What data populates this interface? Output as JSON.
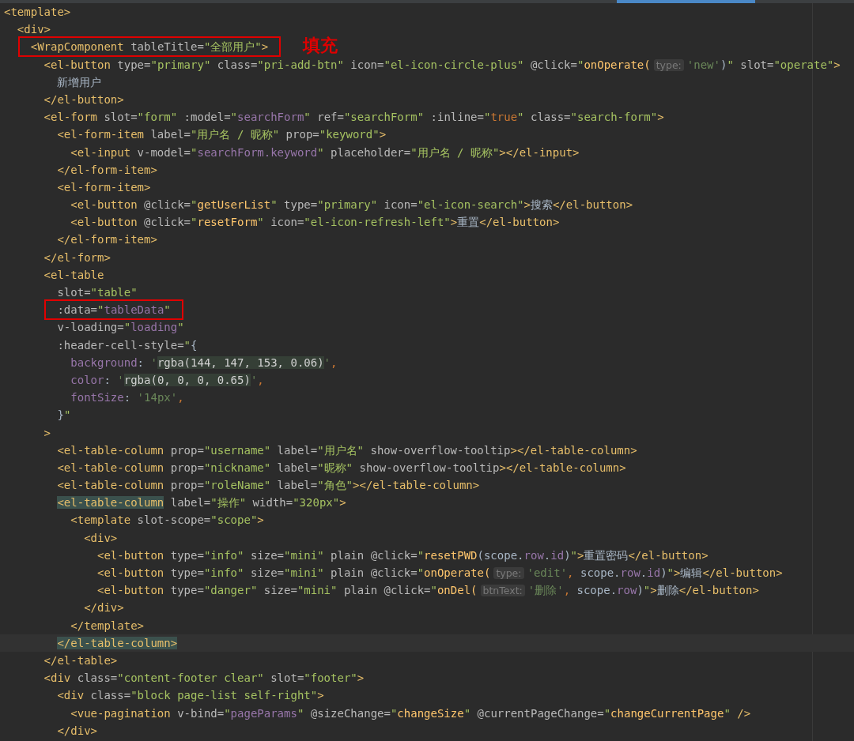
{
  "editor": {
    "lines": [
      {
        "tokens": [
          {
            "kind": "tag",
            "text": "<template>"
          }
        ]
      },
      {
        "tokens": [
          {
            "kind": "tag",
            "text": "  <div>"
          }
        ]
      },
      {
        "boxed": true,
        "note": "填充",
        "tokens": [
          {
            "kind": "tag",
            "text": "    <WrapComponent"
          },
          {
            "kind": "attr",
            "text": " tableTitle="
          },
          {
            "kind": "str",
            "text": "\"全部用户\""
          },
          {
            "kind": "tag",
            "text": ">"
          }
        ]
      },
      {
        "tokens": [
          {
            "kind": "tag",
            "text": "      <el-button"
          },
          {
            "kind": "attr",
            "text": " type="
          },
          {
            "kind": "str",
            "text": "\"primary\""
          },
          {
            "kind": "attr",
            "text": " class="
          },
          {
            "kind": "str",
            "text": "\"pri-add-btn\""
          },
          {
            "kind": "attr",
            "text": " icon="
          },
          {
            "kind": "str",
            "text": "\"el-icon-circle-plus\""
          },
          {
            "kind": "attr",
            "text": " @click="
          },
          {
            "kind": "str",
            "text": "\""
          },
          {
            "kind": "fn",
            "text": "onOperate("
          },
          {
            "kind": "hint",
            "text": "type:"
          },
          {
            "kind": "sq",
            "text": "'new'"
          },
          {
            "kind": "text",
            "text": ")"
          },
          {
            "kind": "str",
            "text": "\""
          },
          {
            "kind": "attr",
            "text": " slot="
          },
          {
            "kind": "str",
            "text": "\"operate\""
          },
          {
            "kind": "tag",
            "text": ">"
          }
        ]
      },
      {
        "tokens": [
          {
            "kind": "text",
            "text": "        新增用户"
          }
        ]
      },
      {
        "tokens": [
          {
            "kind": "tag",
            "text": "      </el-button>"
          }
        ]
      },
      {
        "tokens": [
          {
            "kind": "tag",
            "text": "      <el-form"
          },
          {
            "kind": "attr",
            "text": " slot="
          },
          {
            "kind": "str",
            "text": "\"form\""
          },
          {
            "kind": "attr",
            "text": " :model="
          },
          {
            "kind": "str",
            "text": "\""
          },
          {
            "kind": "bind",
            "text": "searchForm"
          },
          {
            "kind": "str",
            "text": "\""
          },
          {
            "kind": "attr",
            "text": " ref="
          },
          {
            "kind": "str",
            "text": "\"searchForm\""
          },
          {
            "kind": "attr",
            "text": " :inline="
          },
          {
            "kind": "str",
            "text": "\""
          },
          {
            "kind": "kw",
            "text": "true"
          },
          {
            "kind": "str",
            "text": "\""
          },
          {
            "kind": "attr",
            "text": " class="
          },
          {
            "kind": "str",
            "text": "\"search-form\""
          },
          {
            "kind": "tag",
            "text": ">"
          }
        ]
      },
      {
        "tokens": [
          {
            "kind": "tag",
            "text": "        <el-form-item"
          },
          {
            "kind": "attr",
            "text": " label="
          },
          {
            "kind": "str",
            "text": "\"用户名 / 昵称\""
          },
          {
            "kind": "attr",
            "text": " prop="
          },
          {
            "kind": "str",
            "text": "\"keyword\""
          },
          {
            "kind": "tag",
            "text": ">"
          }
        ]
      },
      {
        "tokens": [
          {
            "kind": "tag",
            "text": "          <el-input"
          },
          {
            "kind": "attr",
            "text": " v-model="
          },
          {
            "kind": "str",
            "text": "\""
          },
          {
            "kind": "bind",
            "text": "searchForm.keyword"
          },
          {
            "kind": "str",
            "text": "\""
          },
          {
            "kind": "attr",
            "text": " placeholder="
          },
          {
            "kind": "str",
            "text": "\"用户名 / 昵称\""
          },
          {
            "kind": "tag",
            "text": "></el-input>"
          }
        ]
      },
      {
        "tokens": [
          {
            "kind": "tag",
            "text": "        </el-form-item>"
          }
        ]
      },
      {
        "tokens": [
          {
            "kind": "tag",
            "text": "        <el-form-item>"
          }
        ]
      },
      {
        "tokens": [
          {
            "kind": "tag",
            "text": "          <el-button"
          },
          {
            "kind": "attr",
            "text": " @click="
          },
          {
            "kind": "str",
            "text": "\""
          },
          {
            "kind": "fn",
            "text": "getUserList"
          },
          {
            "kind": "str",
            "text": "\""
          },
          {
            "kind": "attr",
            "text": " type="
          },
          {
            "kind": "str",
            "text": "\"primary\""
          },
          {
            "kind": "attr",
            "text": " icon="
          },
          {
            "kind": "str",
            "text": "\"el-icon-search\""
          },
          {
            "kind": "tag",
            "text": ">"
          },
          {
            "kind": "text",
            "text": "搜索"
          },
          {
            "kind": "tag",
            "text": "</el-button>"
          }
        ]
      },
      {
        "tokens": [
          {
            "kind": "tag",
            "text": "          <el-button"
          },
          {
            "kind": "attr",
            "text": " @click="
          },
          {
            "kind": "str",
            "text": "\""
          },
          {
            "kind": "fn",
            "text": "resetForm"
          },
          {
            "kind": "str",
            "text": "\""
          },
          {
            "kind": "attr",
            "text": " icon="
          },
          {
            "kind": "str",
            "text": "\"el-icon-refresh-left\""
          },
          {
            "kind": "tag",
            "text": ">"
          },
          {
            "kind": "text",
            "text": "重置"
          },
          {
            "kind": "tag",
            "text": "</el-button>"
          }
        ]
      },
      {
        "tokens": [
          {
            "kind": "tag",
            "text": "        </el-form-item>"
          }
        ]
      },
      {
        "tokens": [
          {
            "kind": "tag",
            "text": "      </el-form>"
          }
        ]
      },
      {
        "tokens": [
          {
            "kind": "tag",
            "text": "      <el-table"
          }
        ]
      },
      {
        "tokens": [
          {
            "kind": "attr",
            "text": "        slot="
          },
          {
            "kind": "str",
            "text": "\"table\""
          }
        ]
      },
      {
        "boxed": true,
        "tokens": [
          {
            "kind": "attr",
            "text": "        :data="
          },
          {
            "kind": "str",
            "text": "\""
          },
          {
            "kind": "bind",
            "text": "tableData"
          },
          {
            "kind": "str",
            "text": "\""
          }
        ]
      },
      {
        "tokens": [
          {
            "kind": "attr",
            "text": "        v-loading="
          },
          {
            "kind": "str",
            "text": "\""
          },
          {
            "kind": "bind",
            "text": "loading"
          },
          {
            "kind": "str",
            "text": "\""
          }
        ]
      },
      {
        "tokens": [
          {
            "kind": "attr",
            "text": "        :header-cell-style="
          },
          {
            "kind": "str",
            "text": "\""
          },
          {
            "kind": "text",
            "text": "{"
          }
        ]
      },
      {
        "tokens": [
          {
            "kind": "key",
            "text": "          background"
          },
          {
            "kind": "text",
            "text": ": "
          },
          {
            "kind": "sq",
            "text": "'"
          },
          {
            "kind": "css",
            "text": "rgba(144, 147, 153, 0.06)"
          },
          {
            "kind": "sq",
            "text": "'"
          },
          {
            "kind": "kw",
            "text": ","
          }
        ]
      },
      {
        "tokens": [
          {
            "kind": "key",
            "text": "          color"
          },
          {
            "kind": "text",
            "text": ": "
          },
          {
            "kind": "sq",
            "text": "'"
          },
          {
            "kind": "css",
            "text": "rgba(0, 0, 0, 0.65)"
          },
          {
            "kind": "sq",
            "text": "'"
          },
          {
            "kind": "kw",
            "text": ","
          }
        ]
      },
      {
        "tokens": [
          {
            "kind": "key",
            "text": "          fontSize"
          },
          {
            "kind": "text",
            "text": ": "
          },
          {
            "kind": "sq",
            "text": "'14px'"
          },
          {
            "kind": "kw",
            "text": ","
          }
        ]
      },
      {
        "tokens": [
          {
            "kind": "text",
            "text": "        }"
          },
          {
            "kind": "str",
            "text": "\""
          }
        ]
      },
      {
        "tokens": [
          {
            "kind": "tag",
            "text": "      >"
          }
        ]
      },
      {
        "tokens": [
          {
            "kind": "tag",
            "text": "        <el-table-column"
          },
          {
            "kind": "attr",
            "text": " prop="
          },
          {
            "kind": "str",
            "text": "\"username\""
          },
          {
            "kind": "attr",
            "text": " label="
          },
          {
            "kind": "str",
            "text": "\"用户名\""
          },
          {
            "kind": "attr",
            "text": " show-overflow-tooltip"
          },
          {
            "kind": "tag",
            "text": "></el-table-column>"
          }
        ]
      },
      {
        "tokens": [
          {
            "kind": "tag",
            "text": "        <el-table-column"
          },
          {
            "kind": "attr",
            "text": " prop="
          },
          {
            "kind": "str",
            "text": "\"nickname\""
          },
          {
            "kind": "attr",
            "text": " label="
          },
          {
            "kind": "str",
            "text": "\"昵称\""
          },
          {
            "kind": "attr",
            "text": " show-overflow-tooltip"
          },
          {
            "kind": "tag",
            "text": "></el-table-column>"
          }
        ]
      },
      {
        "tokens": [
          {
            "kind": "tag",
            "text": "        <el-table-column"
          },
          {
            "kind": "attr",
            "text": " prop="
          },
          {
            "kind": "str",
            "text": "\"roleName\""
          },
          {
            "kind": "attr",
            "text": " label="
          },
          {
            "kind": "str",
            "text": "\"角色\""
          },
          {
            "kind": "tag",
            "text": "></el-table-column>"
          }
        ]
      },
      {
        "tokens": [
          {
            "kind": "match",
            "text": "        <el-table-column"
          },
          {
            "kind": "attr",
            "text": " label="
          },
          {
            "kind": "str",
            "text": "\"操作\""
          },
          {
            "kind": "attr",
            "text": " width="
          },
          {
            "kind": "str",
            "text": "\"320px\""
          },
          {
            "kind": "tag",
            "text": ">"
          }
        ]
      },
      {
        "tokens": [
          {
            "kind": "tag",
            "text": "          <template"
          },
          {
            "kind": "attr",
            "text": " slot-scope="
          },
          {
            "kind": "str",
            "text": "\"scope\""
          },
          {
            "kind": "tag",
            "text": ">"
          }
        ]
      },
      {
        "tokens": [
          {
            "kind": "tag",
            "text": "            <div>"
          }
        ]
      },
      {
        "tokens": [
          {
            "kind": "tag",
            "text": "              <el-button"
          },
          {
            "kind": "attr",
            "text": " type="
          },
          {
            "kind": "str",
            "text": "\"info\""
          },
          {
            "kind": "attr",
            "text": " size="
          },
          {
            "kind": "str",
            "text": "\"mini\""
          },
          {
            "kind": "attr",
            "text": " plain @click="
          },
          {
            "kind": "str",
            "text": "\""
          },
          {
            "kind": "fn",
            "text": "resetPWD"
          },
          {
            "kind": "text",
            "text": "(scope."
          },
          {
            "kind": "bind",
            "text": "row"
          },
          {
            "kind": "text",
            "text": "."
          },
          {
            "kind": "bind",
            "text": "id"
          },
          {
            "kind": "text",
            "text": ")"
          },
          {
            "kind": "str",
            "text": "\""
          },
          {
            "kind": "tag",
            "text": ">"
          },
          {
            "kind": "text",
            "text": "重置密码"
          },
          {
            "kind": "tag",
            "text": "</el-button>"
          }
        ]
      },
      {
        "tokens": [
          {
            "kind": "tag",
            "text": "              <el-button"
          },
          {
            "kind": "attr",
            "text": " type="
          },
          {
            "kind": "str",
            "text": "\"info\""
          },
          {
            "kind": "attr",
            "text": " size="
          },
          {
            "kind": "str",
            "text": "\"mini\""
          },
          {
            "kind": "attr",
            "text": " plain @click="
          },
          {
            "kind": "str",
            "text": "\""
          },
          {
            "kind": "fn",
            "text": "onOperate("
          },
          {
            "kind": "hint",
            "text": "type:"
          },
          {
            "kind": "sq",
            "text": "'edit'"
          },
          {
            "kind": "kw",
            "text": ","
          },
          {
            "kind": "text",
            "text": " scope."
          },
          {
            "kind": "bind",
            "text": "row"
          },
          {
            "kind": "text",
            "text": "."
          },
          {
            "kind": "bind",
            "text": "id"
          },
          {
            "kind": "text",
            "text": ")"
          },
          {
            "kind": "str",
            "text": "\""
          },
          {
            "kind": "tag",
            "text": ">"
          },
          {
            "kind": "text",
            "text": "编辑"
          },
          {
            "kind": "tag",
            "text": "</el-button>"
          }
        ]
      },
      {
        "tokens": [
          {
            "kind": "tag",
            "text": "              <el-button"
          },
          {
            "kind": "attr",
            "text": " type="
          },
          {
            "kind": "str",
            "text": "\"danger\""
          },
          {
            "kind": "attr",
            "text": " size="
          },
          {
            "kind": "str",
            "text": "\"mini\""
          },
          {
            "kind": "attr",
            "text": " plain @click="
          },
          {
            "kind": "str",
            "text": "\""
          },
          {
            "kind": "fn",
            "text": "onDel("
          },
          {
            "kind": "hint",
            "text": "btnText:"
          },
          {
            "kind": "sq",
            "text": "'删除'"
          },
          {
            "kind": "kw",
            "text": ","
          },
          {
            "kind": "text",
            "text": " scope."
          },
          {
            "kind": "bind",
            "text": "row"
          },
          {
            "kind": "text",
            "text": ")"
          },
          {
            "kind": "str",
            "text": "\""
          },
          {
            "kind": "tag",
            "text": ">"
          },
          {
            "kind": "text",
            "text": "删除"
          },
          {
            "kind": "tag",
            "text": "</el-button>"
          }
        ]
      },
      {
        "tokens": [
          {
            "kind": "tag",
            "text": "            </div>"
          }
        ]
      },
      {
        "tokens": [
          {
            "kind": "tag",
            "text": "          </template>"
          }
        ]
      },
      {
        "current": true,
        "tokens": [
          {
            "kind": "match",
            "text": "        </el-table-column>"
          }
        ]
      },
      {
        "tokens": [
          {
            "kind": "tag",
            "text": "      </el-table>"
          }
        ]
      },
      {
        "tokens": [
          {
            "kind": "tag",
            "text": "      <div"
          },
          {
            "kind": "attr",
            "text": " class="
          },
          {
            "kind": "str",
            "text": "\"content-footer clear\""
          },
          {
            "kind": "attr",
            "text": " slot="
          },
          {
            "kind": "str",
            "text": "\"footer\""
          },
          {
            "kind": "tag",
            "text": ">"
          }
        ]
      },
      {
        "tokens": [
          {
            "kind": "tag",
            "text": "        <div"
          },
          {
            "kind": "attr",
            "text": " class="
          },
          {
            "kind": "str",
            "text": "\"block page-list self-right\""
          },
          {
            "kind": "tag",
            "text": ">"
          }
        ]
      },
      {
        "tokens": [
          {
            "kind": "tag",
            "text": "          <vue-pagination"
          },
          {
            "kind": "attr",
            "text": " v-bind="
          },
          {
            "kind": "str",
            "text": "\""
          },
          {
            "kind": "bind",
            "text": "pageParams"
          },
          {
            "kind": "str",
            "text": "\""
          },
          {
            "kind": "attr",
            "text": " @sizeChange="
          },
          {
            "kind": "str",
            "text": "\""
          },
          {
            "kind": "fn",
            "text": "changeSize"
          },
          {
            "kind": "str",
            "text": "\""
          },
          {
            "kind": "attr",
            "text": " @currentPageChange="
          },
          {
            "kind": "str",
            "text": "\""
          },
          {
            "kind": "fn",
            "text": "changeCurrentPage"
          },
          {
            "kind": "str",
            "text": "\""
          },
          {
            "kind": "tag",
            "text": " />"
          }
        ]
      },
      {
        "tokens": [
          {
            "kind": "tag",
            "text": "        </div>"
          }
        ]
      }
    ]
  }
}
